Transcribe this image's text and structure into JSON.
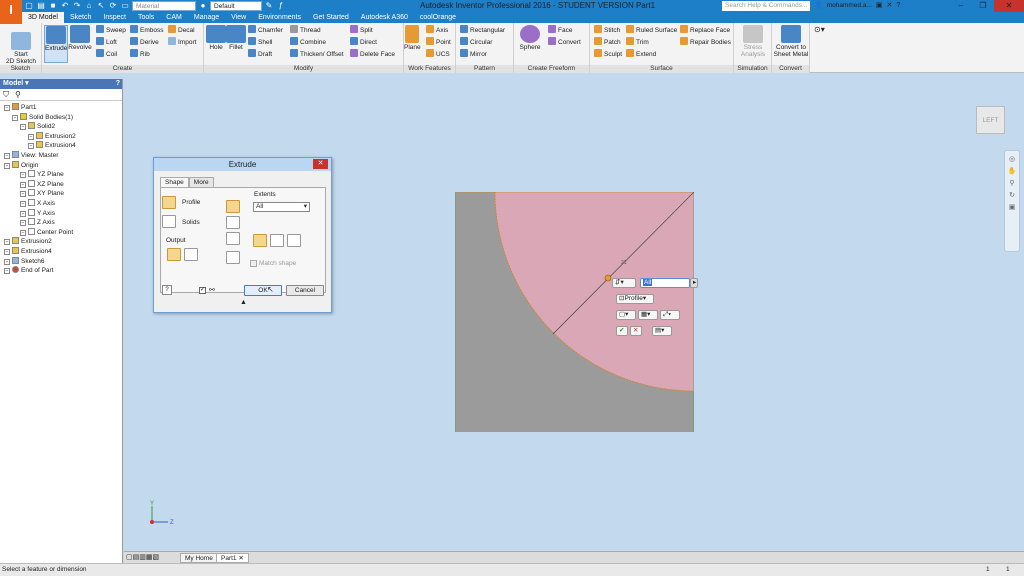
{
  "titlebar": {
    "logo": "I",
    "material_dropdown": "Material",
    "appearance_dropdown": "Default",
    "title": "Autodesk Inventor Professional 2016 - STUDENT VERSION    Part1",
    "search_placeholder": "Search Help & Commands...",
    "user": "mohammed.a..."
  },
  "ribbon_tabs": [
    "3D Model",
    "Sketch",
    "Inspect",
    "Tools",
    "CAM",
    "Manage",
    "View",
    "Environments",
    "Get Started",
    "Autodesk A360",
    "coolOrange"
  ],
  "ribbon": {
    "sketch_panel": {
      "label": "Sketch",
      "start_sketch": "Start\n2D Sketch"
    },
    "create_panel": {
      "label": "Create",
      "extrude": "Extrude",
      "revolve": "Revolve",
      "sweep": "Sweep",
      "loft": "Loft",
      "coil": "Coil",
      "emboss": "Emboss",
      "derive": "Derive",
      "rib": "Rib",
      "decal": "Decal",
      "import": "Import"
    },
    "modify_panel": {
      "label": "Modify",
      "hole": "Hole",
      "fillet": "Fillet",
      "chamfer": "Chamfer",
      "shell": "Shell",
      "draft": "Draft",
      "thread": "Thread",
      "combine": "Combine",
      "thicken": "Thicken/ Offset",
      "split": "Split",
      "direct": "Direct",
      "delete_face": "Delete Face"
    },
    "work_features_panel": {
      "label": "Work Features",
      "plane": "Plane",
      "axis": "Axis",
      "point": "Point",
      "ucs": "UCS"
    },
    "pattern_panel": {
      "label": "Pattern",
      "rectangular": "Rectangular",
      "circular": "Circular",
      "mirror": "Mirror"
    },
    "freeform_panel": {
      "label": "Create Freeform",
      "sphere": "Sphere",
      "face": "Face",
      "convert": "Convert"
    },
    "surface_panel": {
      "label": "Surface",
      "stitch": "Stitch",
      "patch": "Patch",
      "sculpt": "Sculpt",
      "ruled_surface": "Ruled Surface",
      "trim": "Trim",
      "extend": "Extend",
      "replace_face": "Replace Face",
      "repair_bodies": "Repair Bodies"
    },
    "simulation_panel": {
      "label": "Simulation",
      "stress": "Stress\nAnalysis"
    },
    "convert_panel": {
      "label": "Convert",
      "sheet_metal": "Convert to\nSheet Metal"
    }
  },
  "browser": {
    "header": "Model",
    "tree": [
      {
        "label": "Part1",
        "indent": 0,
        "icon": "part-icon"
      },
      {
        "label": "Solid Bodies(1)",
        "indent": 1,
        "icon": "folder-icon"
      },
      {
        "label": "Solid2",
        "indent": 2,
        "icon": "solid-icon"
      },
      {
        "label": "Extrusion2",
        "indent": 3,
        "icon": "extrusion-icon"
      },
      {
        "label": "Extrusion4",
        "indent": 3,
        "icon": "extrusion-icon"
      },
      {
        "label": "View: Master",
        "indent": 0,
        "icon": "view-icon"
      },
      {
        "label": "Origin",
        "indent": 0,
        "icon": "folder-icon"
      },
      {
        "label": "YZ Plane",
        "indent": 2,
        "icon": "plane-icon"
      },
      {
        "label": "XZ Plane",
        "indent": 2,
        "icon": "plane-icon"
      },
      {
        "label": "XY Plane",
        "indent": 2,
        "icon": "plane-icon"
      },
      {
        "label": "X Axis",
        "indent": 2,
        "icon": "axis-icon"
      },
      {
        "label": "Y Axis",
        "indent": 2,
        "icon": "axis-icon"
      },
      {
        "label": "Z Axis",
        "indent": 2,
        "icon": "axis-icon"
      },
      {
        "label": "Center Point",
        "indent": 2,
        "icon": "point-icon"
      },
      {
        "label": "Extrusion2",
        "indent": 0,
        "icon": "extrusion-icon"
      },
      {
        "label": "Extrusion4",
        "indent": 0,
        "icon": "extrusion-icon"
      },
      {
        "label": "Sketch6",
        "indent": 0,
        "icon": "sketch-icon"
      },
      {
        "label": "End of Part",
        "indent": 0,
        "icon": "end-icon"
      }
    ]
  },
  "viewcube": {
    "face": "LEFT"
  },
  "sketch_dimension": "21",
  "mini_toolbar": {
    "distance_value": "All",
    "profile": "Profile"
  },
  "dialog": {
    "title": "Extrude",
    "tabs": [
      "Shape",
      "More"
    ],
    "profile": "Profile",
    "solids": "Solids",
    "output": "Output",
    "extents": "Extents",
    "extents_value": "All",
    "match_shape": "Match shape",
    "ok": "OK",
    "cancel": "Cancel"
  },
  "doc_tabs": {
    "home": "My Home",
    "part": "Part1"
  },
  "triad": {
    "y": "Y",
    "z": "Z"
  },
  "status": {
    "message": "Select a feature or dimension",
    "n1": "1",
    "n2": "1"
  }
}
